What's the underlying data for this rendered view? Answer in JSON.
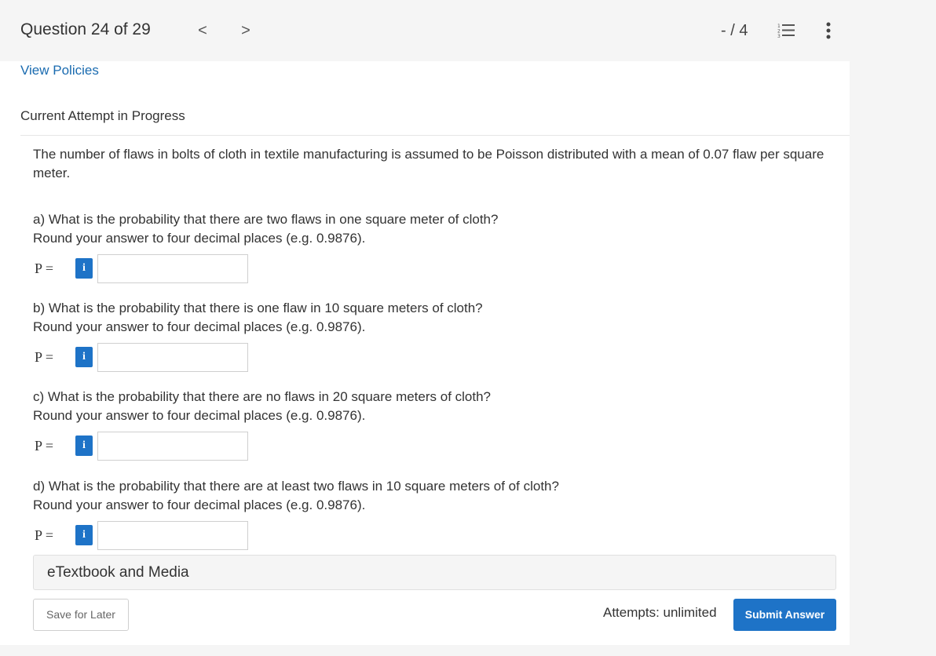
{
  "header": {
    "question_label": "Question 24 of 29",
    "prev_glyph": "<",
    "next_glyph": ">",
    "score": "- / 4",
    "list_icon": "list-icon",
    "more_icon": "more-vertical-icon"
  },
  "policies_link": "View Policies",
  "attempt_heading": "Current Attempt in Progress",
  "stem": "The number of flaws in bolts of cloth in textile manufacturing is assumed to be Poisson distributed with a mean of 0.07 flaw per square meter.",
  "parts": [
    {
      "question": "a) What is the probability that there are two flaws in one square meter of cloth?",
      "instruction": "Round your answer to four decimal places (e.g. 0.9876).",
      "label": "P =",
      "info_glyph": "i",
      "value": ""
    },
    {
      "question": "b) What is the probability that there is one flaw in 10 square meters of cloth?",
      "instruction": "Round your answer to four decimal places (e.g. 0.9876).",
      "label": "P =",
      "info_glyph": "i",
      "value": ""
    },
    {
      "question": "c) What is the probability that there are no flaws in 20 square meters of cloth?",
      "instruction": "Round your answer to four decimal places (e.g. 0.9876).",
      "label": "P =",
      "info_glyph": "i",
      "value": ""
    },
    {
      "question": "d) What is the probability that there are at least two flaws in 10 square meters of of cloth?",
      "instruction": "Round your answer to four decimal places (e.g. 0.9876).",
      "label": "P =",
      "info_glyph": "i",
      "value": ""
    }
  ],
  "etextbook_label": "eTextbook and Media",
  "save_label": "Save for Later",
  "attempts_text": "Attempts: unlimited",
  "submit_label": "Submit Answer",
  "colors": {
    "accent": "#1e73c7",
    "link": "#1a6bb0",
    "background": "#f5f5f5",
    "panel": "#ffffff"
  }
}
